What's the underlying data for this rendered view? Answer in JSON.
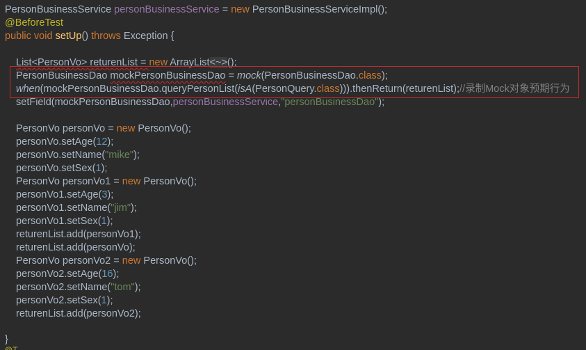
{
  "code": {
    "l1": {
      "type": "PersonBusinessService",
      "field": "personBusinessService",
      "eq": "=",
      "new": "new",
      "ctor": "PersonBusinessServiceImpl();"
    },
    "l2": {
      "annotation": "@BeforeTest"
    },
    "l3": {
      "public": "public",
      "void": "void",
      "method": "setUp",
      "parens": "()",
      "throws": "throws",
      "rest": "Exception {"
    },
    "l4": {
      "decl": "List<PersonVo> returenList = ",
      "new": "new",
      "cls": "ArrayList",
      "hint": "<~>",
      "end": "();"
    },
    "l5": {
      "type": "PersonBusinessDao",
      "var": "mockPersonBusinessDao",
      "eq": " = ",
      "mock": "mock",
      "arg1": "(PersonBusinessDao.",
      "class": "class",
      "end": ");"
    },
    "l6": {
      "when": "when",
      "a1": "(mockPersonBusinessDao.queryPersonList(",
      "isA": "isA",
      "a2": "(PersonQuery.",
      "class": "class",
      "a3": "))).thenReturn(returenList);",
      "comment": "//录制Mock对象预期行为"
    },
    "l7": {
      "a1": "setField(mockPersonBusinessDao,",
      "field": "personBusinessService",
      "comma": ",",
      "str": "\"personBusinessDao\"",
      "end": ");"
    },
    "l9": {
      "a1": "PersonVo personVo = ",
      "new": "new",
      "a2": " PersonVo();"
    },
    "l10": {
      "a1": "personVo.setAge(",
      "num": "12",
      "a2": ");"
    },
    "l11": {
      "a1": "personVo.setName(",
      "str": "\"mike\"",
      "a2": ");"
    },
    "l12": {
      "a1": "personVo.setSex(",
      "num": "1",
      "a2": ");"
    },
    "l13": {
      "a1": "PersonVo personVo1 = ",
      "new": "new",
      "a2": " PersonVo();"
    },
    "l14": {
      "a1": "personVo1.setAge(",
      "num": "3",
      "a2": ");"
    },
    "l15": {
      "a1": "personVo1.setName(",
      "str": "\"jim\"",
      "a2": ");"
    },
    "l16": {
      "a1": "personVo1.setSex(",
      "num": "1",
      "a2": ");"
    },
    "l17": {
      "text": "returenList.add(personVo1);"
    },
    "l18": {
      "text": "returenList.add(personVo);"
    },
    "l19": {
      "a1": "PersonVo personVo2 = ",
      "new": "new",
      "a2": " PersonVo();"
    },
    "l20": {
      "a1": "personVo2.setAge(",
      "num": "16",
      "a2": ");"
    },
    "l21": {
      "a1": "personVo2.setName(",
      "str": "\"tom\"",
      "a2": ");"
    },
    "l22": {
      "a1": "personVo2.setSex(",
      "num": "1",
      "a2": ");"
    },
    "l23": {
      "text": "returenList.add(personVo2);"
    },
    "l25": {
      "text": "}"
    },
    "l26": {
      "text": "@T"
    }
  },
  "colors": {
    "background": "#2b2b2b",
    "default_text": "#a9b7c6",
    "keyword": "#cc7832",
    "field": "#9876aa",
    "string": "#6a8759",
    "number": "#6897bb",
    "annotation": "#bbb529",
    "method_decl": "#ffc66d",
    "comment": "#808080",
    "highlight_box": "#c12a2a"
  }
}
